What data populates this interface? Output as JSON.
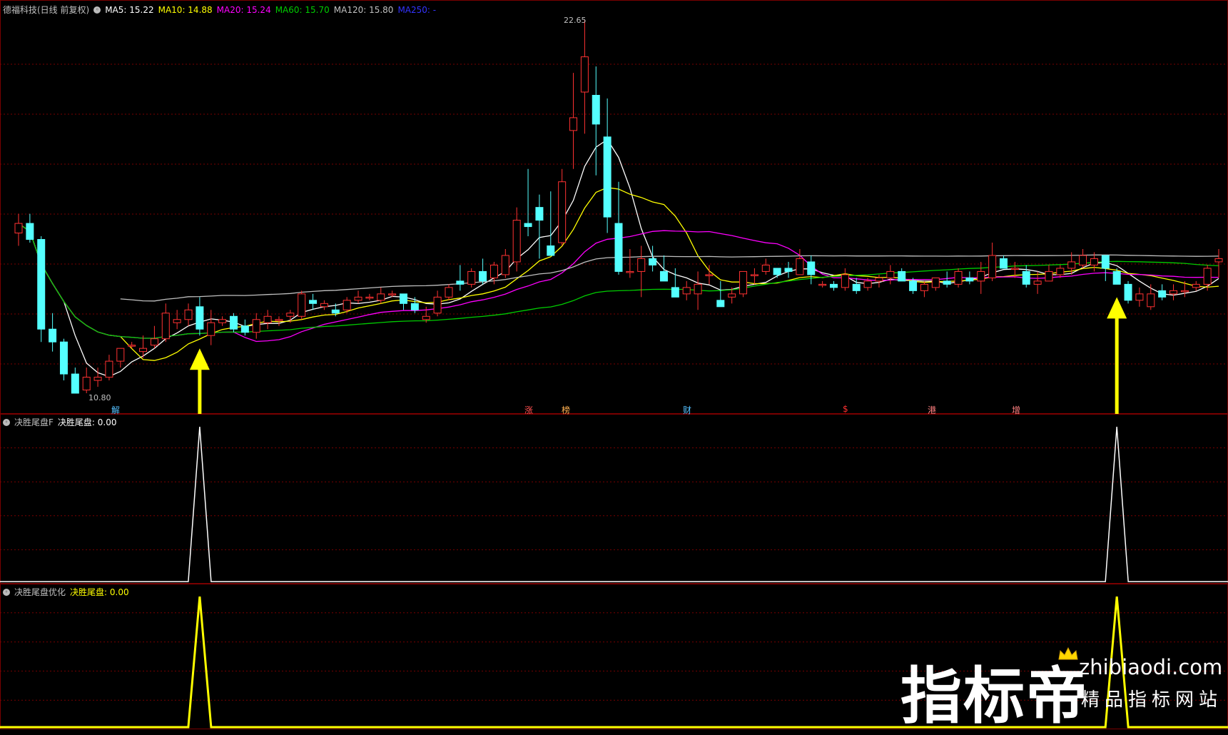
{
  "main": {
    "title": "德福科技(日线 前复权)",
    "ma": [
      {
        "label": "MA5: 15.22",
        "color": "#ffffff"
      },
      {
        "label": "MA10: 14.88",
        "color": "#ffff00"
      },
      {
        "label": "MA20: 15.24",
        "color": "#ff00ff"
      },
      {
        "label": "MA60: 15.70",
        "color": "#00cc00"
      },
      {
        "label": "MA120: 15.80",
        "color": "#c0c0c0"
      },
      {
        "label": "MA250: -",
        "color": "#0000ff"
      }
    ],
    "high_label": "22.65",
    "low_label": "10.80",
    "events": [
      "解",
      "涨",
      "榜",
      "财",
      "$",
      "港",
      "增"
    ]
  },
  "indicator1": {
    "name": "决胜尾盘F",
    "value_label": "决胜尾盘: 0.00"
  },
  "indicator2": {
    "name": "决胜尾盘优化",
    "value_label": "决胜尾盘: 0.00"
  },
  "watermark": {
    "brand": "指标帝",
    "url": "zhibiaodi.com",
    "slogan": "精品指标网站"
  },
  "colors": {
    "up": "#ff3232",
    "down": "#54ffff",
    "grid": "#7a0000",
    "signal1": "#ffffff",
    "signal2": "#ffff00",
    "arrow": "#ffff00"
  },
  "chart_data": {
    "type": "candlestick",
    "price_range": [
      10.8,
      22.65
    ],
    "candles": [
      [
        16.0,
        16.6,
        15.6,
        16.3
      ],
      [
        16.3,
        16.6,
        15.7,
        15.8
      ],
      [
        15.8,
        15.9,
        12.6,
        13.0
      ],
      [
        13.0,
        13.5,
        12.3,
        12.6
      ],
      [
        12.6,
        12.7,
        11.4,
        11.6
      ],
      [
        11.6,
        11.8,
        11.0,
        11.0
      ],
      [
        11.1,
        11.8,
        11.0,
        11.5
      ],
      [
        11.4,
        11.8,
        11.2,
        11.5
      ],
      [
        11.5,
        12.2,
        11.4,
        12.0
      ],
      [
        12.0,
        12.4,
        11.8,
        12.4
      ],
      [
        12.5,
        12.6,
        12.4,
        12.5
      ],
      [
        12.3,
        12.8,
        12.1,
        12.4
      ],
      [
        12.5,
        13.1,
        12.4,
        12.7
      ],
      [
        12.7,
        13.8,
        12.6,
        13.5
      ],
      [
        13.2,
        13.6,
        13.0,
        13.3
      ],
      [
        13.3,
        13.8,
        13.1,
        13.6
      ],
      [
        13.7,
        14.0,
        12.8,
        13.0
      ],
      [
        12.8,
        13.6,
        12.5,
        13.2
      ],
      [
        13.2,
        13.4,
        13.1,
        13.3
      ],
      [
        13.4,
        13.5,
        12.9,
        13.0
      ],
      [
        13.1,
        13.3,
        12.8,
        12.9
      ],
      [
        12.9,
        13.5,
        12.7,
        13.3
      ],
      [
        13.2,
        13.6,
        13.0,
        13.4
      ],
      [
        13.3,
        13.4,
        13.1,
        13.3
      ],
      [
        13.4,
        13.6,
        13.2,
        13.5
      ],
      [
        13.4,
        14.2,
        13.3,
        14.1
      ],
      [
        13.9,
        14.1,
        13.6,
        13.8
      ],
      [
        13.7,
        13.9,
        13.6,
        13.8
      ],
      [
        13.6,
        13.8,
        13.4,
        13.5
      ],
      [
        13.6,
        14.0,
        13.5,
        13.9
      ],
      [
        13.9,
        14.2,
        13.8,
        14.0
      ],
      [
        14.0,
        14.1,
        13.9,
        14.0
      ],
      [
        13.9,
        14.3,
        13.8,
        14.1
      ],
      [
        14.1,
        14.2,
        14.0,
        14.1
      ],
      [
        14.1,
        14.1,
        13.6,
        13.8
      ],
      [
        13.8,
        14.0,
        13.5,
        13.6
      ],
      [
        13.3,
        13.7,
        13.2,
        13.4
      ],
      [
        13.5,
        14.2,
        13.4,
        14.0
      ],
      [
        14.0,
        14.4,
        13.9,
        14.3
      ],
      [
        14.5,
        15.0,
        14.2,
        14.4
      ],
      [
        14.4,
        14.9,
        14.3,
        14.8
      ],
      [
        14.8,
        15.2,
        14.4,
        14.5
      ],
      [
        14.6,
        15.1,
        14.4,
        15.0
      ],
      [
        14.7,
        15.5,
        14.6,
        15.3
      ],
      [
        15.1,
        16.8,
        14.8,
        16.4
      ],
      [
        16.3,
        18.0,
        15.9,
        16.2
      ],
      [
        16.8,
        17.2,
        15.2,
        16.4
      ],
      [
        15.6,
        17.3,
        15.3,
        15.3
      ],
      [
        15.7,
        18.0,
        15.6,
        17.6
      ],
      [
        19.2,
        21.0,
        18.0,
        19.6
      ],
      [
        20.4,
        22.65,
        19.1,
        21.5
      ],
      [
        20.3,
        21.2,
        17.8,
        19.4
      ],
      [
        19.0,
        20.2,
        16.0,
        16.5
      ],
      [
        16.3,
        17.6,
        14.7,
        14.8
      ],
      [
        14.8,
        15.5,
        14.6,
        14.8
      ],
      [
        14.8,
        15.6,
        14.0,
        15.2
      ],
      [
        15.2,
        15.6,
        14.8,
        15.0
      ],
      [
        14.8,
        15.3,
        14.5,
        14.5
      ],
      [
        14.3,
        14.9,
        14.1,
        14.0
      ],
      [
        14.1,
        14.5,
        13.9,
        14.3
      ],
      [
        14.1,
        14.8,
        13.6,
        14.4
      ],
      [
        14.7,
        15.0,
        14.4,
        14.7
      ],
      [
        13.9,
        14.5,
        13.7,
        13.7
      ],
      [
        14.0,
        14.3,
        13.8,
        14.1
      ],
      [
        14.1,
        14.8,
        14.0,
        14.8
      ],
      [
        14.7,
        14.9,
        14.4,
        14.7
      ],
      [
        14.8,
        15.2,
        14.7,
        15.0
      ],
      [
        14.9,
        14.8,
        14.6,
        14.7
      ],
      [
        14.9,
        15.1,
        14.6,
        14.8
      ],
      [
        14.7,
        15.5,
        14.7,
        15.2
      ],
      [
        15.1,
        15.3,
        14.4,
        14.7
      ],
      [
        14.4,
        14.5,
        14.3,
        14.4
      ],
      [
        14.4,
        14.5,
        14.2,
        14.3
      ],
      [
        14.3,
        14.9,
        14.2,
        14.7
      ],
      [
        14.4,
        14.6,
        14.1,
        14.2
      ],
      [
        14.3,
        14.6,
        14.2,
        14.5
      ],
      [
        14.5,
        14.7,
        14.3,
        14.6
      ],
      [
        14.6,
        15.0,
        14.4,
        14.8
      ],
      [
        14.8,
        14.9,
        14.5,
        14.5
      ],
      [
        14.5,
        14.6,
        14.1,
        14.2
      ],
      [
        14.2,
        14.5,
        14.0,
        14.4
      ],
      [
        14.3,
        14.6,
        14.2,
        14.6
      ],
      [
        14.5,
        14.8,
        14.3,
        14.4
      ],
      [
        14.4,
        14.9,
        14.3,
        14.8
      ],
      [
        14.6,
        14.8,
        14.4,
        14.5
      ],
      [
        14.5,
        15.1,
        14.1,
        14.8
      ],
      [
        14.6,
        15.7,
        14.5,
        15.3
      ],
      [
        15.2,
        15.3,
        14.9,
        14.9
      ],
      [
        14.9,
        15.1,
        14.6,
        14.9
      ],
      [
        14.8,
        15.0,
        14.3,
        14.4
      ],
      [
        14.4,
        14.8,
        14.1,
        14.5
      ],
      [
        14.5,
        15.0,
        14.5,
        14.8
      ],
      [
        14.7,
        15.0,
        14.6,
        14.9
      ],
      [
        14.9,
        15.4,
        14.7,
        15.1
      ],
      [
        15.0,
        15.5,
        14.9,
        15.3
      ],
      [
        15.0,
        15.4,
        14.8,
        15.2
      ],
      [
        15.3,
        15.3,
        14.5,
        14.9
      ],
      [
        14.8,
        14.9,
        14.4,
        14.4
      ],
      [
        14.4,
        14.5,
        13.8,
        13.9
      ],
      [
        13.9,
        14.3,
        13.7,
        14.1
      ],
      [
        13.7,
        14.4,
        13.6,
        14.1
      ],
      [
        14.2,
        14.4,
        13.9,
        14.0
      ],
      [
        14.1,
        14.4,
        13.9,
        14.2
      ],
      [
        14.2,
        14.5,
        14.0,
        14.2
      ],
      [
        14.3,
        14.5,
        14.2,
        14.4
      ],
      [
        14.4,
        15.0,
        14.2,
        14.9
      ],
      [
        15.1,
        15.5,
        14.6,
        15.2
      ]
    ],
    "signal_index": [
      16,
      97
    ]
  }
}
